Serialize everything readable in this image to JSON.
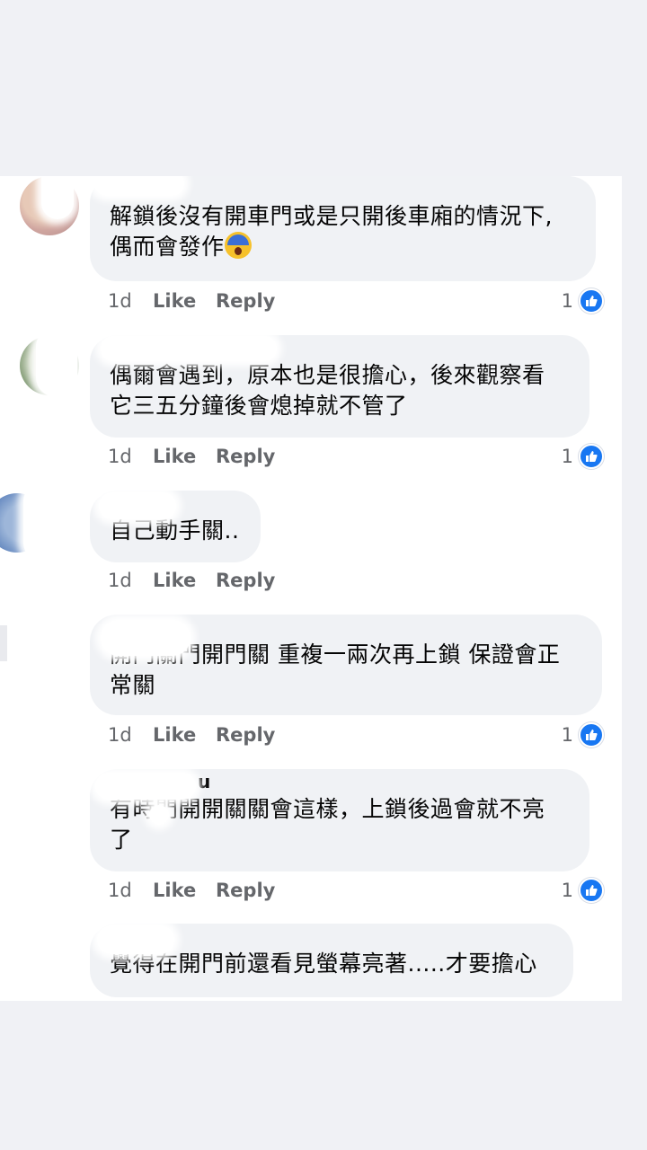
{
  "comments": [
    {
      "text_lines": [
        "解鎖後沒有開車門或是只開後車廂的情況下,",
        "偶而會發作"
      ],
      "emoji": "screaming-face-emoji",
      "time": "1d",
      "like": "Like",
      "reply": "Reply",
      "reactions": "1"
    },
    {
      "text_lines": [
        "偶爾會遇到，原本也是很擔心，後來觀察看",
        "它三五分鐘後會熄掉就不管了"
      ],
      "time": "1d",
      "like": "Like",
      "reply": "Reply",
      "reactions": "1"
    },
    {
      "text_lines": [
        "自己動手關.."
      ],
      "time": "1d",
      "like": "Like",
      "reply": "Reply"
    },
    {
      "text_lines": [
        "開門關門開門關 重複一兩次再上鎖 保證會正",
        "常關"
      ],
      "time": "1d",
      "like": "Like",
      "reply": "Reply",
      "reactions": "1"
    },
    {
      "name_fragment": "u",
      "text_lines": [
        "有時門開開關關會這樣，上鎖後過會就不亮",
        "了"
      ],
      "time": "1d",
      "like": "Like",
      "reply": "Reply",
      "reactions": "1"
    },
    {
      "text_lines": [
        "覺得在開門前還看見螢幕亮著.....才要擔心"
      ]
    }
  ],
  "colors": {
    "background": "#f0f1f5",
    "bubble": "#f0f2f5",
    "meta_text": "#65676b",
    "like_blue": "#1877f2"
  }
}
